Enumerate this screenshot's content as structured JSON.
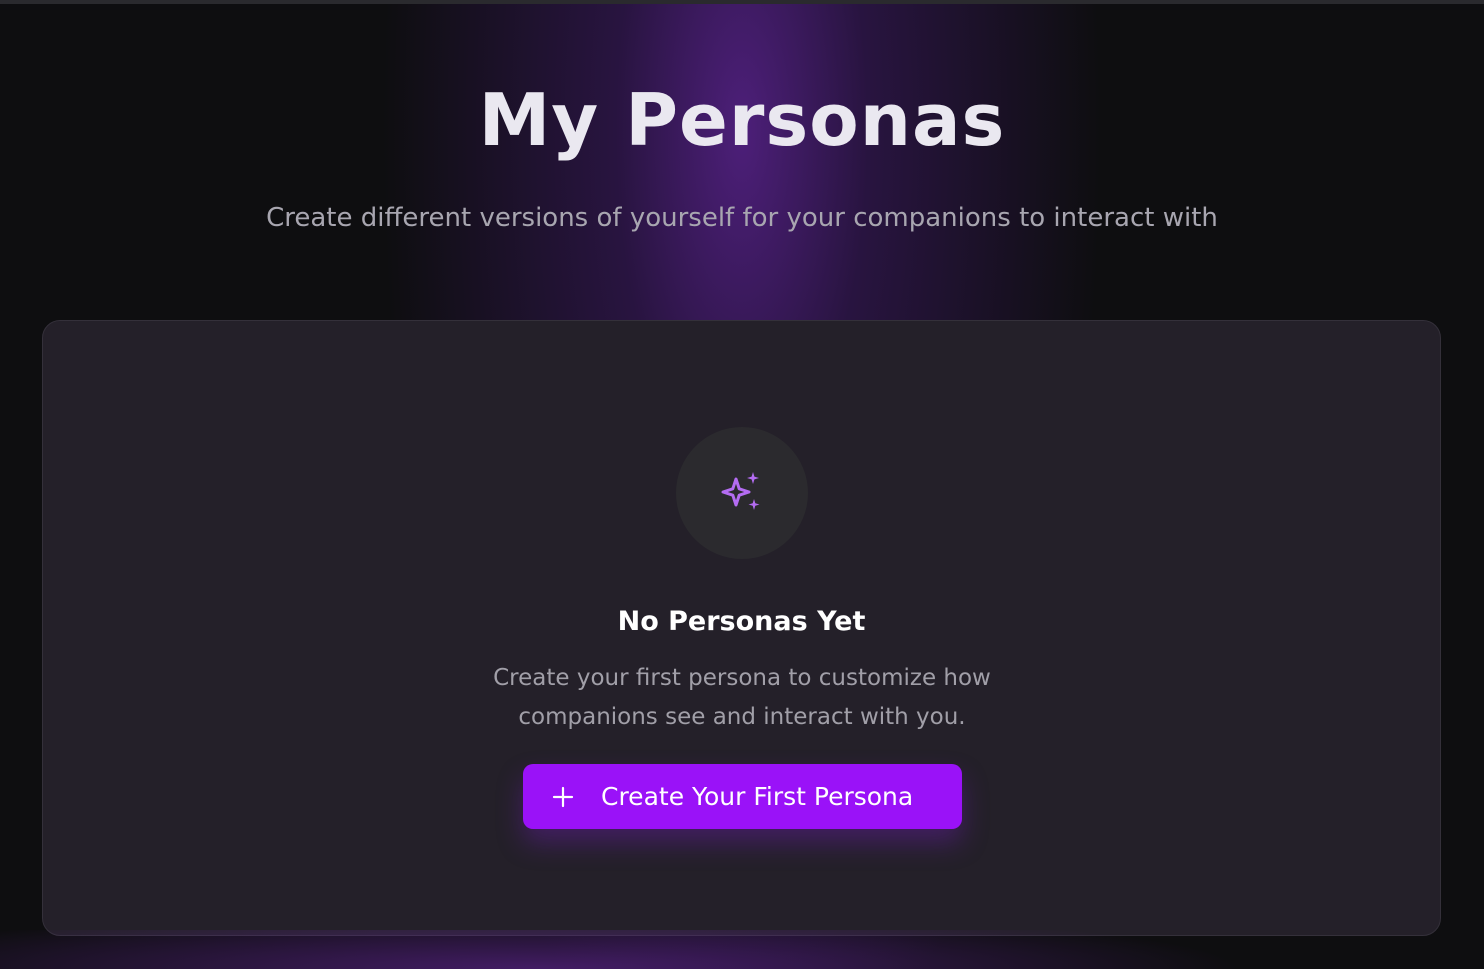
{
  "header": {
    "title": "My Personas",
    "subtitle": "Create different versions of yourself for your companions to interact with"
  },
  "empty_state": {
    "icon": "sparkles-icon",
    "title": "No Personas Yet",
    "description": "Create your first persona to customize how companions see and interact with you.",
    "button": {
      "icon": "plus-icon",
      "label": "Create Your First Persona"
    }
  },
  "colors": {
    "background": "#0e0e10",
    "card": "#242029",
    "accent": "#9a12f8",
    "icon": "#b46cf2"
  }
}
